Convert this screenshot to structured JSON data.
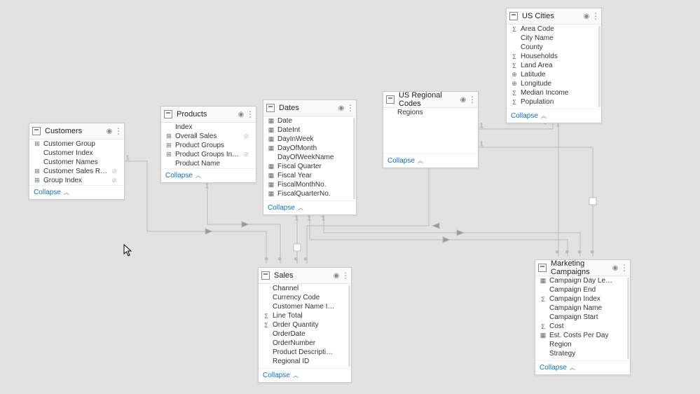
{
  "collapse_label": "Collapse",
  "tables": {
    "customers": {
      "title": "Customers",
      "fields": [
        {
          "icon": "hier",
          "name": "Customer Group",
          "hidden": false
        },
        {
          "icon": "",
          "name": "Customer Index",
          "hidden": false
        },
        {
          "icon": "",
          "name": "Customer Names",
          "hidden": false
        },
        {
          "icon": "hier",
          "name": "Customer Sales Rank",
          "hidden": true
        },
        {
          "icon": "hier",
          "name": "Group Index",
          "hidden": true
        }
      ]
    },
    "products": {
      "title": "Products",
      "fields": [
        {
          "icon": "",
          "name": "Index",
          "hidden": false
        },
        {
          "icon": "hier",
          "name": "Overall Sales",
          "hidden": true
        },
        {
          "icon": "hier",
          "name": "Product Groups",
          "hidden": false
        },
        {
          "icon": "hier",
          "name": "Product Groups Index",
          "hidden": true
        },
        {
          "icon": "",
          "name": "Product Name",
          "hidden": false
        }
      ]
    },
    "dates": {
      "title": "Dates",
      "fields": [
        {
          "icon": "cal",
          "name": "Date",
          "hidden": false
        },
        {
          "icon": "cal",
          "name": "DateInt",
          "hidden": false
        },
        {
          "icon": "cal",
          "name": "DayInWeek",
          "hidden": false
        },
        {
          "icon": "cal",
          "name": "DayOfMonth",
          "hidden": false
        },
        {
          "icon": "",
          "name": "DayOfWeekName",
          "hidden": false
        },
        {
          "icon": "cal",
          "name": "Fiscal Quarter",
          "hidden": false
        },
        {
          "icon": "cal",
          "name": "Fiscal Year",
          "hidden": false
        },
        {
          "icon": "cal",
          "name": "FiscalMonthNo.",
          "hidden": false
        },
        {
          "icon": "cal",
          "name": "FiscalQuarterNo.",
          "hidden": false
        }
      ]
    },
    "regional": {
      "title": "US Regional Codes",
      "fields": [
        {
          "icon": "",
          "name": "Regions",
          "hidden": false
        }
      ]
    },
    "cities": {
      "title": "US Cities",
      "fields": [
        {
          "icon": "sum",
          "name": "Area Code",
          "hidden": false
        },
        {
          "icon": "",
          "name": "City Name",
          "hidden": false
        },
        {
          "icon": "",
          "name": "County",
          "hidden": false
        },
        {
          "icon": "sum",
          "name": "Households",
          "hidden": false
        },
        {
          "icon": "sum",
          "name": "Land Area",
          "hidden": false
        },
        {
          "icon": "geo",
          "name": "Latitude",
          "hidden": false
        },
        {
          "icon": "geo",
          "name": "Longitude",
          "hidden": false
        },
        {
          "icon": "sum",
          "name": "Median Income",
          "hidden": false
        },
        {
          "icon": "sum",
          "name": "Population",
          "hidden": false
        }
      ]
    },
    "sales": {
      "title": "Sales",
      "fields": [
        {
          "icon": "",
          "name": "Channel",
          "hidden": false
        },
        {
          "icon": "",
          "name": "Currency Code",
          "hidden": false
        },
        {
          "icon": "",
          "name": "Customer Name Index",
          "hidden": false
        },
        {
          "icon": "sum",
          "name": "Line Total",
          "hidden": false
        },
        {
          "icon": "sum",
          "name": "Order Quantity",
          "hidden": false
        },
        {
          "icon": "",
          "name": "OrderDate",
          "hidden": false
        },
        {
          "icon": "",
          "name": "OrderNumber",
          "hidden": false
        },
        {
          "icon": "",
          "name": "Product Description Index",
          "hidden": false
        },
        {
          "icon": "",
          "name": "Regional ID",
          "hidden": false
        }
      ]
    },
    "marketing": {
      "title": "Marketing Campaigns",
      "fields": [
        {
          "icon": "cal",
          "name": "Campaign Day Length",
          "hidden": false
        },
        {
          "icon": "",
          "name": "Campaign End",
          "hidden": false
        },
        {
          "icon": "sum",
          "name": "Campaign Index",
          "hidden": false
        },
        {
          "icon": "",
          "name": "Campaign Name",
          "hidden": false
        },
        {
          "icon": "",
          "name": "Campaign Start",
          "hidden": false
        },
        {
          "icon": "sum",
          "name": "Cost",
          "hidden": false
        },
        {
          "icon": "cal",
          "name": "Est. Costs Per Day",
          "hidden": false
        },
        {
          "icon": "",
          "name": "Region",
          "hidden": false
        },
        {
          "icon": "",
          "name": "Strategy",
          "hidden": false
        }
      ]
    }
  },
  "relationships": [
    {
      "from": "customers",
      "from_side": "right",
      "from_card": "1",
      "to": "sales",
      "to_side": "top",
      "to_card": "*"
    },
    {
      "from": "products",
      "from_side": "bottom",
      "from_card": "1",
      "to": "sales",
      "to_side": "top",
      "to_card": "*"
    },
    {
      "from": "dates",
      "from_side": "bottom",
      "from_card": "1",
      "to": "sales",
      "to_side": "top",
      "to_card": "*"
    },
    {
      "from": "dates",
      "from_side": "bottom",
      "from_card": "1",
      "to": "marketing",
      "to_side": "top",
      "to_card": "*"
    },
    {
      "from": "regional",
      "from_side": "bottom",
      "from_card": "1",
      "to": "sales",
      "to_side": "top",
      "to_card": "*"
    },
    {
      "from": "regional",
      "from_side": "right",
      "from_card": "1",
      "to": "marketing",
      "to_side": "top",
      "to_card": "*"
    },
    {
      "from": "cities",
      "from_side": "bottom",
      "from_card": "1",
      "to": "marketing",
      "to_side": "top",
      "to_card": "*"
    },
    {
      "from": "cities",
      "from_side": "bottom",
      "from_card": "*",
      "to": "regional",
      "to_side": "right",
      "to_card": "1"
    },
    {
      "from": "dates",
      "from_side": "bottom",
      "from_card": "1",
      "to": "marketing",
      "to_side": "top",
      "to_card": "*"
    }
  ]
}
